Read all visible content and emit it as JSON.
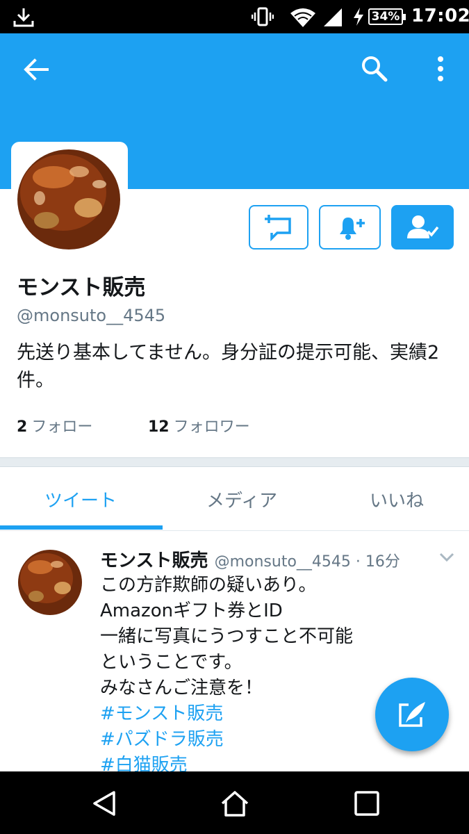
{
  "status_bar": {
    "battery": "34%",
    "time": "17:02",
    "icons": [
      "download-icon",
      "vibrate-icon",
      "wifi-icon",
      "signal-icon",
      "charging-icon",
      "battery-icon"
    ]
  },
  "header": {
    "icons": [
      "back-arrow-icon",
      "search-icon",
      "more-vertical-icon"
    ],
    "accent_color": "#1da1f2"
  },
  "profile": {
    "name": "モンスト販売",
    "handle": "@monsuto__4545",
    "bio": "先送り基本してません。身分証の提示可能、実績2件。",
    "following_count": "2",
    "following_label": "フォロー",
    "followers_count": "12",
    "followers_label": "フォロワー",
    "buttons": [
      "direct-message-icon",
      "notification-bell-plus-icon",
      "following-user-check-icon"
    ]
  },
  "tabs": [
    {
      "label": "ツイート",
      "active": true
    },
    {
      "label": "メディア",
      "active": false
    },
    {
      "label": "いいね",
      "active": false
    }
  ],
  "tweet": {
    "name": "モンスト販売",
    "meta": "@monsuto__4545 · 16分",
    "lines": [
      "この方詐欺師の疑いあり。",
      "Amazonギフト券とID",
      "一緒に写真にうつすこと不可能",
      "ということです。",
      "みなさんご注意を！"
    ],
    "hashtags": [
      "#モンスト販売",
      "#パズドラ販売",
      "#白猫販売"
    ]
  },
  "fab": {
    "icon": "compose-tweet-icon"
  },
  "nav_bar": {
    "icons": [
      "nav-back-icon",
      "nav-home-icon",
      "nav-recents-icon"
    ]
  }
}
